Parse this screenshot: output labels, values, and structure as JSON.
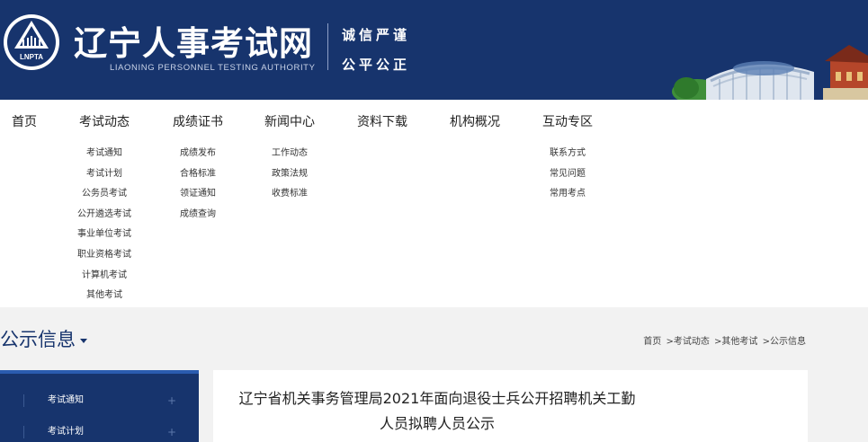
{
  "header": {
    "logo_text": "LNPTA",
    "site_title": "辽宁人事考试网",
    "site_subtitle": "LIAONING PERSONNEL TESTING AUTHORITY",
    "motto_line1": "诚信严谨",
    "motto_line2": "公平公正",
    "colors": {
      "header_bg": "#17346d",
      "accent": "#2a5cb0"
    }
  },
  "nav": {
    "items": [
      {
        "label": "首页",
        "sub": []
      },
      {
        "label": "考试动态",
        "sub": [
          "考试通知",
          "考试计划",
          "公务员考试",
          "公开遴选考试",
          "事业单位考试",
          "职业资格考试",
          "计算机考试",
          "其他考试"
        ]
      },
      {
        "label": "成绩证书",
        "sub": [
          "成绩发布",
          "合格标准",
          "领证通知",
          "成绩查询"
        ]
      },
      {
        "label": "新闻中心",
        "sub": [
          "工作动态",
          "政策法规",
          "收费标准"
        ]
      },
      {
        "label": "资料下载",
        "sub": []
      },
      {
        "label": "机构概况",
        "sub": []
      },
      {
        "label": "互动专区",
        "sub": [
          "联系方式",
          "常见问题",
          "常用考点"
        ]
      }
    ]
  },
  "page": {
    "title": "公示信息",
    "breadcrumb": [
      "首页",
      ">考试动态",
      ">其他考试",
      ">公示信息"
    ]
  },
  "sidebar": {
    "items": [
      {
        "label": "考试通知",
        "icon": "plus-icon"
      },
      {
        "label": "考试计划",
        "icon": "plus-icon"
      }
    ]
  },
  "article": {
    "title_line1": "辽宁省机关事务管理局2021年面向退役士兵公开招聘机关工勤",
    "title_line2": "人员拟聘人员公示"
  }
}
